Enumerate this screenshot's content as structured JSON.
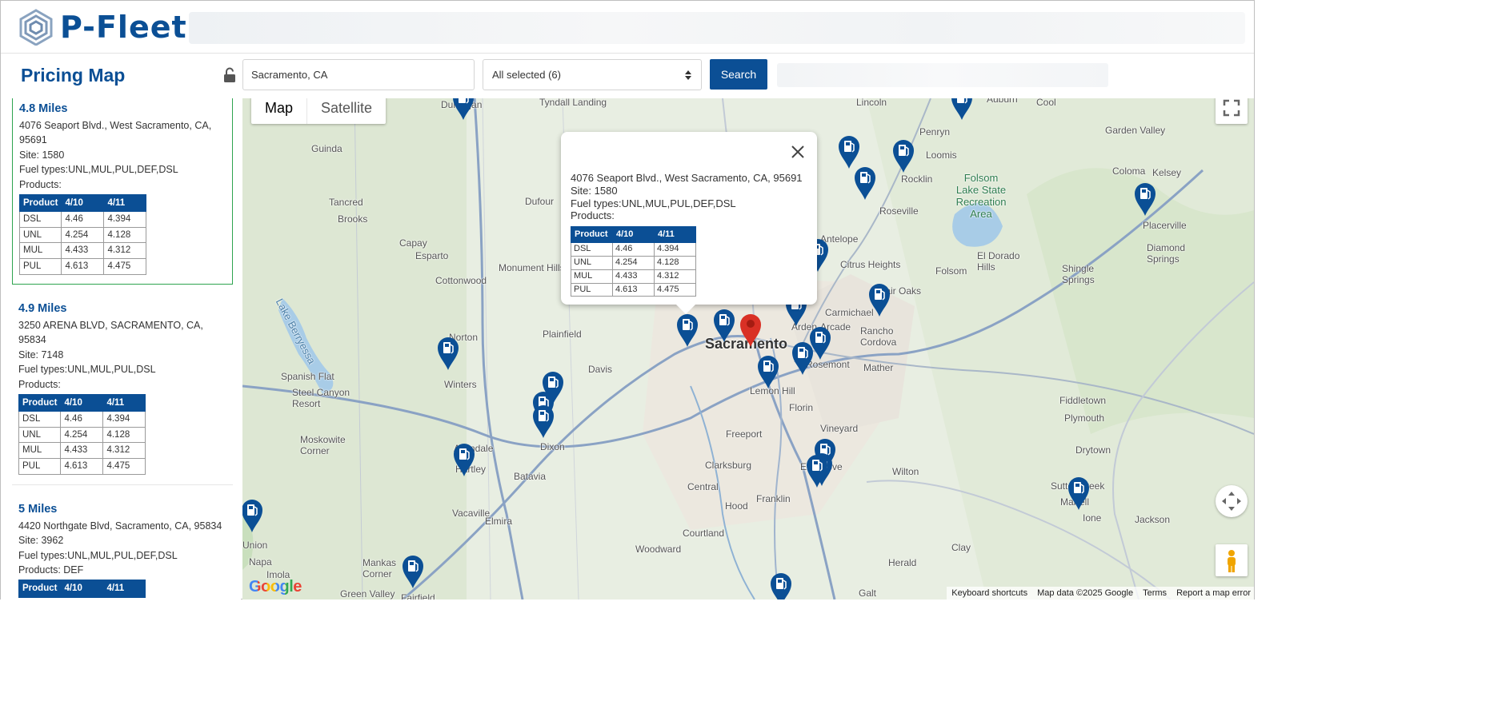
{
  "header": {
    "logo_text": "P-Fleet"
  },
  "toolbar": {
    "page_title": "Pricing Map",
    "location_value": "Sacramento, CA",
    "fuel_filter_label": "All selected (6)",
    "search_label": "Search"
  },
  "sidebar": {
    "results": [
      {
        "distance": "4.8 Miles",
        "address": "4076 Seaport Blvd., West Sacramento, CA, 95691",
        "site": "Site: 1580",
        "fuel_types": "Fuel types:UNL,MUL,PUL,DEF,DSL",
        "products": "Products:",
        "table": {
          "headers": [
            "Product",
            "4/10",
            "4/11"
          ],
          "rows": [
            [
              "DSL",
              "4.46",
              "4.394"
            ],
            [
              "UNL",
              "4.254",
              "4.128"
            ],
            [
              "MUL",
              "4.433",
              "4.312"
            ],
            [
              "PUL",
              "4.613",
              "4.475"
            ]
          ]
        }
      },
      {
        "distance": "4.9 Miles",
        "address": "3250 ARENA BLVD, SACRAMENTO, CA, 95834",
        "site": "Site: 7148",
        "fuel_types": "Fuel types:UNL,MUL,PUL,DSL",
        "products": "Products:",
        "table": {
          "headers": [
            "Product",
            "4/10",
            "4/11"
          ],
          "rows": [
            [
              "DSL",
              "4.46",
              "4.394"
            ],
            [
              "UNL",
              "4.254",
              "4.128"
            ],
            [
              "MUL",
              "4.433",
              "4.312"
            ],
            [
              "PUL",
              "4.613",
              "4.475"
            ]
          ]
        }
      },
      {
        "distance": "5 Miles",
        "address": "4420 Northgate Blvd, Sacramento, CA, 95834",
        "site": "Site: 3962",
        "fuel_types": "Fuel types:UNL,MUL,PUL,DEF,DSL",
        "products": "Products: DEF",
        "table": {
          "headers": [
            "Product",
            "4/10",
            "4/11"
          ],
          "rows": []
        }
      }
    ]
  },
  "map": {
    "type_map": "Map",
    "type_satellite": "Satellite",
    "attribution": {
      "shortcuts": "Keyboard shortcuts",
      "data": "Map data ©2025 Google",
      "terms": "Terms",
      "report": "Report a map error"
    },
    "google_logo": "Google",
    "info_window": {
      "address": "4076 Seaport Blvd., West Sacramento, CA, 95691",
      "site": "Site: 1580",
      "fuel_types": "Fuel types:UNL,MUL,PUL,DEF,DSL",
      "products": "Products:",
      "table": {
        "headers": [
          "Product",
          "4/10",
          "4/11"
        ],
        "rows": [
          [
            "DSL",
            "4.46",
            "4.394"
          ],
          [
            "UNL",
            "4.254",
            "4.128"
          ],
          [
            "MUL",
            "4.433",
            "4.312"
          ],
          [
            "PUL",
            "4.613",
            "4.475"
          ]
        ]
      }
    },
    "places": [
      "Dunnigan",
      "Tyndall Landing",
      "Lincoln",
      "Auburn",
      "Cool",
      "Guinda",
      "Garden Valley",
      "Penryn",
      "Loomis",
      "Rocklin",
      "Coloma",
      "Kelsey",
      "Tancred",
      "Brooks",
      "Dufour",
      "Folsom Lake State Recreation Area",
      "Roseville",
      "Capay",
      "Esparto",
      "Antelope",
      "Citrus Heights",
      "El Dorado Hills",
      "Placerville",
      "Diamond Springs",
      "Monument Hills",
      "Cottonwood",
      "Folsom",
      "Shingle Springs",
      "Fair Oaks",
      "Carmichael",
      "Arden-Arcade",
      "Rancho Cordova",
      "Norton",
      "Plainfield",
      "Sacramento",
      "Lake Berryessa",
      "Davis",
      "Rosemont",
      "Mather",
      "Winters",
      "Spanish Flat",
      "Steel Canyon Resort",
      "Lemon Hill",
      "Florin",
      "Fiddletown",
      "Vineyard",
      "Plymouth",
      "Moskowite Corner",
      "Dixon",
      "Freeport",
      "Drytown",
      "Allendale",
      "Hartley",
      "Batavia",
      "Clarksburg",
      "Elk Grove",
      "Wilton",
      "Sutter Creek",
      "Central",
      "Hood",
      "Franklin",
      "Martell",
      "Vacaville",
      "Elmira",
      "Ione",
      "Jackson",
      "Courtland",
      "Clay",
      "Union",
      "Napa",
      "Woodward",
      "Herald",
      "Mankas Corner",
      "Imola",
      "Green Valley",
      "Fairfield",
      "Galt"
    ],
    "colors": {
      "brand": "#0b4f95",
      "selected_pin": "#d93025",
      "active_border": "#2ea44f"
    }
  }
}
